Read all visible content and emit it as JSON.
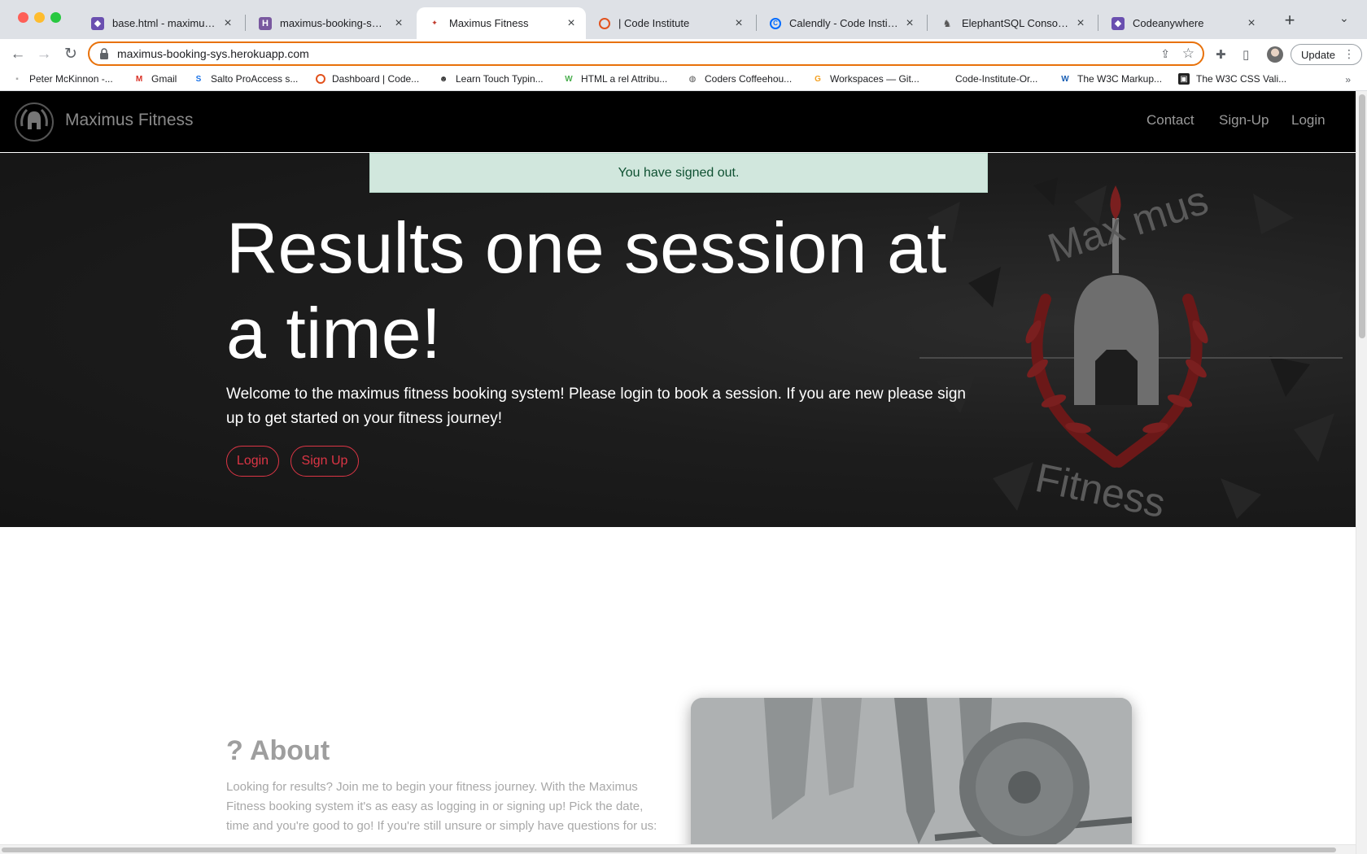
{
  "browser": {
    "tabs": [
      {
        "title": "base.html - maximusfitness",
        "fav_color": "#6a4fb0"
      },
      {
        "title": "maximus-booking-sys · A",
        "fav_color": "#79589f"
      },
      {
        "title": "Maximus Fitness",
        "fav_color": "#c0392b"
      },
      {
        "title": "| Code Institute",
        "fav_color": "#e2521d"
      },
      {
        "title": "Calendly - Code Institute",
        "fav_color": "#006bff"
      },
      {
        "title": "ElephantSQL Console ma",
        "fav_color": "#555555"
      },
      {
        "title": "Codeanywhere",
        "fav_color": "#6a4fb0"
      }
    ],
    "url": "maximus-booking-sys.herokuapp.com",
    "update_label": "Update",
    "bookmarks": [
      {
        "label": "Peter McKinnon -..."
      },
      {
        "label": "Gmail"
      },
      {
        "label": "Salto ProAccess s..."
      },
      {
        "label": "Dashboard | Code..."
      },
      {
        "label": "Learn Touch Typin..."
      },
      {
        "label": "HTML a rel Attribu..."
      },
      {
        "label": "Coders Coffeehou..."
      },
      {
        "label": "Workspaces — Git..."
      },
      {
        "label": "Code-Institute-Or..."
      },
      {
        "label": "The W3C Markup..."
      },
      {
        "label": "The W3C CSS Vali..."
      }
    ],
    "bookmarks_more": "»"
  },
  "site": {
    "brand": "Maximus Fitness",
    "nav": {
      "contact": "Contact",
      "signup": "Sign-Up",
      "login": "Login"
    },
    "alert": "You have signed out.",
    "hero": {
      "title": "Results one session at a time!",
      "text": "Welcome to the maximus fitness booking system! Please login to book a session. If you are new please sign up to get started on your fitness journey!",
      "login_button": "Login",
      "signup_button": "Sign Up",
      "logo_top_text": "Max mus",
      "logo_bottom_text": "Fitness"
    },
    "about": {
      "title": "? About",
      "text": "Looking for results? Join me to begin your fitness journey. With the Maximus Fitness booking system it's as easy as logging in or signing up! Pick the date, time and you're good to go! If you're still unsure or simply have questions for us:"
    }
  },
  "colors": {
    "accent": "#dc3545",
    "alert_bg": "#d1e7dd",
    "alert_text": "#0f5132",
    "nav_bg": "#000000",
    "omnibox_focus": "#e8710a"
  },
  "icons": {
    "back": "back-arrow-icon",
    "forward": "forward-arrow-icon",
    "reload": "reload-icon",
    "lock": "lock-icon",
    "share": "share-icon",
    "star": "star-icon",
    "extensions": "puzzle-icon",
    "sidepanel": "side-panel-icon",
    "menu": "kebab-menu-icon"
  }
}
